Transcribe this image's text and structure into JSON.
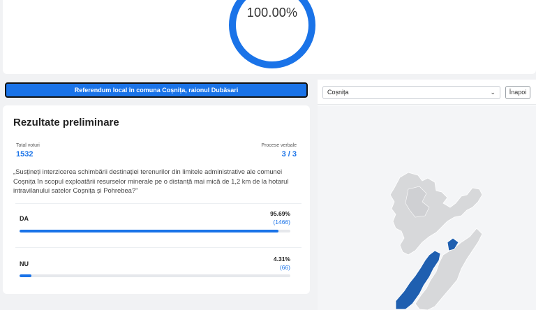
{
  "turnout": {
    "percent_label": "100.00%",
    "fraction": 1.0
  },
  "banner": {
    "label": "Referendum local în comuna Coșnița, raionul Dubăsari"
  },
  "results": {
    "title": "Rezultate preliminare",
    "total_votes_label": "Total voturi",
    "total_votes": "1532",
    "protocols_label": "Procese verbale",
    "protocols": "3 / 3",
    "question": "„Susțineți interzicerea schimbării destinației terenurilor din limitele administrative ale comunei Coșnița în scopul exploatării resurselor minerale pe o distanță mai mică de 1,2 km de la hotarul intravilanului satelor Coșnița și Pohrebea?\"",
    "options": [
      {
        "name": "DA",
        "percent": "95.69%",
        "count": "(1466)",
        "fraction": 0.9569
      },
      {
        "name": "NU",
        "percent": "4.31%",
        "count": "(66)",
        "fraction": 0.0431
      }
    ]
  },
  "map": {
    "selected_locality": "Coșnița",
    "back_label": "Înapoi",
    "colors": {
      "highlight": "#1f5fb0",
      "land": "#d7d8da"
    }
  },
  "colors": {
    "accent": "#1a73e8"
  }
}
